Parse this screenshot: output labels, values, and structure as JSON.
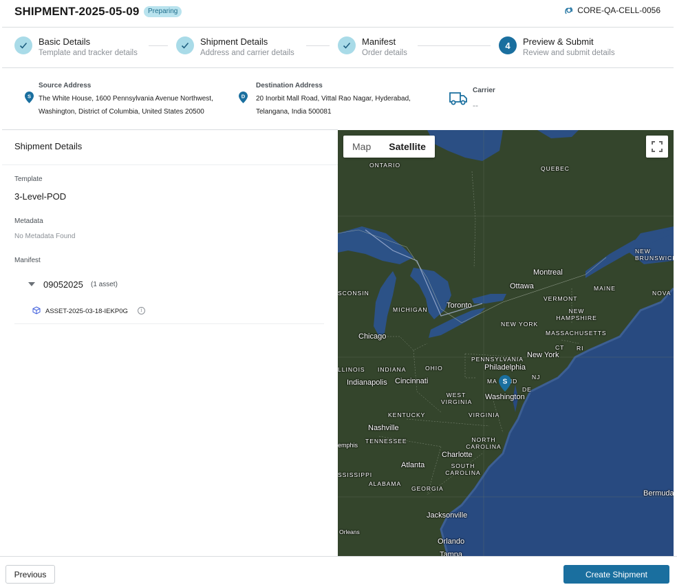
{
  "header": {
    "title": "SHIPMENT-2025-05-09",
    "status": "Preparing",
    "device": "CORE-QA-CELL-0056"
  },
  "steps": [
    {
      "label": "Basic Details",
      "sub": "Template and tracker details",
      "state": "done"
    },
    {
      "label": "Shipment Details",
      "sub": "Address and carrier details",
      "state": "done"
    },
    {
      "label": "Manifest",
      "sub": "Order details",
      "state": "done"
    },
    {
      "label": "Preview & Submit",
      "sub": "Review and submit details",
      "state": "active",
      "number": "4"
    }
  ],
  "addresses": {
    "source": {
      "label": "Source Address",
      "pin": "S",
      "line1": "The White House, 1600 Pennsylvania Avenue Northwest,",
      "line2": "Washington, District of Columbia, United States 20500"
    },
    "destination": {
      "label": "Destination Address",
      "pin": "D",
      "line1": "20 Inorbit Mall Road, Vittal Rao Nagar, Hyderabad,",
      "line2": "Telangana, India 500081"
    },
    "carrier": {
      "label": "Carrier",
      "value": "--"
    }
  },
  "details": {
    "section_title": "Shipment Details",
    "template_label": "Template",
    "template_value": "3-Level-POD",
    "metadata_label": "Metadata",
    "metadata_value": "No Metadata Found",
    "manifest_label": "Manifest",
    "manifest_id": "09052025",
    "manifest_count": "(1 asset)",
    "asset_id": "ASSET-2025-03-18-IEKP0G",
    "info_glyph": "i"
  },
  "map": {
    "type_map": "Map",
    "type_satellite": "Satellite",
    "marker_label": "S",
    "labels": {
      "ontario": "ONTARIO",
      "quebec": "QUEBEC",
      "new_brunswick": "NEW BRUNSWICK",
      "montreal": "Montreal",
      "ottawa": "Ottawa",
      "maine": "MAINE",
      "nova": "NOVA",
      "vermont": "VERMONT",
      "wisconsin": "SCONSIN",
      "michigan": "MICHIGAN",
      "toronto": "Toronto",
      "new_york_state": "NEW YORK",
      "new_hampshire": "NEW HAMPSHIRE",
      "massachusetts": "MASSACHUSETTS",
      "chicago": "Chicago",
      "ct": "CT",
      "ri": "RI",
      "pennsylvania": "PENNSYLVANIA",
      "new_york_city": "New York",
      "illinois": "LLINOIS",
      "indiana": "INDIANA",
      "ohio": "OHIO",
      "philadelphia": "Philadelphia",
      "indianapolis": "Indianapolis",
      "cincinnati": "Cincinnati",
      "maryland": "MA    LAND",
      "nj": "NJ",
      "west_virginia": "WEST VIRGINIA",
      "de": "DE",
      "washington": "Washington",
      "kentucky": "KENTUCKY",
      "virginia": "VIRGINIA",
      "nashville": "Nashville",
      "tennessee": "TENNESSEE",
      "memphis": "emphis",
      "north_carolina": "NORTH CAROLINA",
      "charlotte": "Charlotte",
      "atlanta": "Atlanta",
      "south_carolina": "SOUTH CAROLINA",
      "mississippi": "SSISSIPPI",
      "alabama": "ALABAMA",
      "georgia": "GEORGIA",
      "bermuda": "Bermuda",
      "jacksonville": "Jacksonville",
      "orleans": "Orleans",
      "orlando": "Orlando",
      "tampa": "Tampa"
    }
  },
  "footer": {
    "previous": "Previous",
    "create": "Create Shipment"
  },
  "colors": {
    "accent": "#1a6f9f",
    "done_step": "#a9dbe8",
    "badge_bg": "#b9e3ee"
  }
}
